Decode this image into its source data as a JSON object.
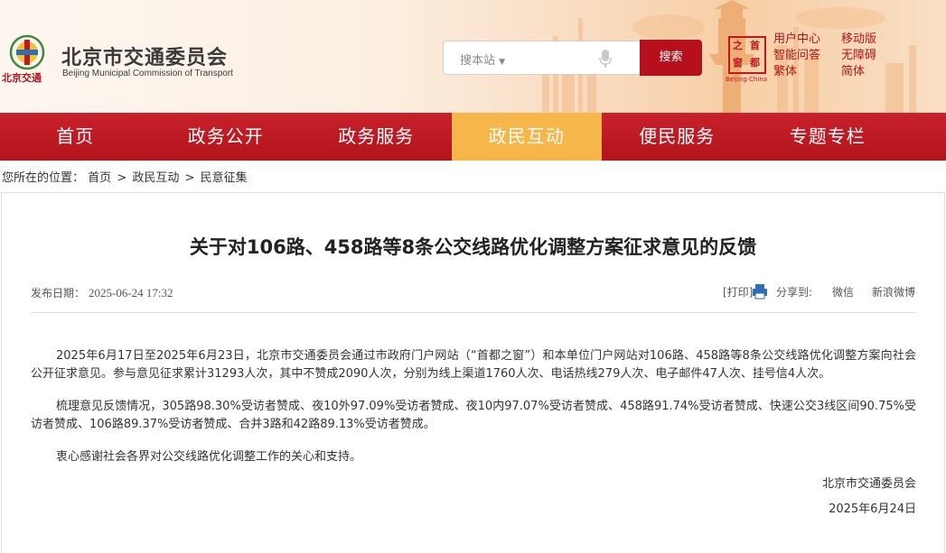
{
  "header": {
    "logo_text": "北京交通",
    "logo_text_en": "Beijing Municipal Commission of Transport",
    "site_title": "北京市交通委员会",
    "site_title_en": "Beijing Municipal Commission of Transport",
    "search": {
      "scope_label": "搜本站",
      "button_label": "搜索"
    },
    "capital_seal": {
      "chars": [
        "首",
        "都",
        "之",
        "窗"
      ],
      "caption": "Beijing·China"
    },
    "links_col1": [
      "用户中心",
      "智能问答",
      "繁体"
    ],
    "links_col2": [
      "移动版",
      "无障碍",
      "简体"
    ]
  },
  "nav": {
    "items": [
      "首页",
      "政务公开",
      "政务服务",
      "政民互动",
      "便民服务",
      "专题专栏"
    ],
    "active_index": 3
  },
  "breadcrumb": {
    "prefix": "您所在的位置：",
    "items": [
      "首页",
      "政民互动",
      "民意征集"
    ],
    "separator": ">"
  },
  "article": {
    "title": "关于对106路、458路等8条公交线路优化调整方案征求意见的反馈",
    "date_label": "发布日期：",
    "date_value": "2025-06-24 17:32",
    "print_label": "[打印]",
    "share_label": "分享到:",
    "share_targets": [
      "微信",
      "新浪微博"
    ],
    "paragraphs": [
      "2025年6月17日至2025年6月23日，北京市交通委员会通过市政府门户网站（“首都之窗”）和本单位门户网站对106路、458路等8条公交线路优化调整方案向社会公开征求意见。参与意见征求累计31293人次，其中不赞成2090人次，分别为线上渠道1760人次、电话热线279人次、电子邮件47人次、挂号信4人次。",
      "梳理意见反馈情况，305路98.30%受访者赞成、夜10外97.09%受访者赞成、夜10内97.07%受访者赞成、458路91.74%受访者赞成、快速公交3线区间90.75%受访者赞成、106路89.37%受访者赞成、合并3路和42路89.13%受访者赞成。",
      "衷心感谢社会各界对公交线路优化调整工作的关心和支持。"
    ],
    "signature_org": "北京市交通委员会",
    "signature_date": "2025年6月24日"
  },
  "colors": {
    "brand_red": "#b5101b",
    "nav_active": "#f6b64a",
    "seal_red": "#c0161f"
  },
  "icons": [
    "emblem-icon",
    "chevron-down-icon",
    "mic-icon",
    "print-icon"
  ]
}
